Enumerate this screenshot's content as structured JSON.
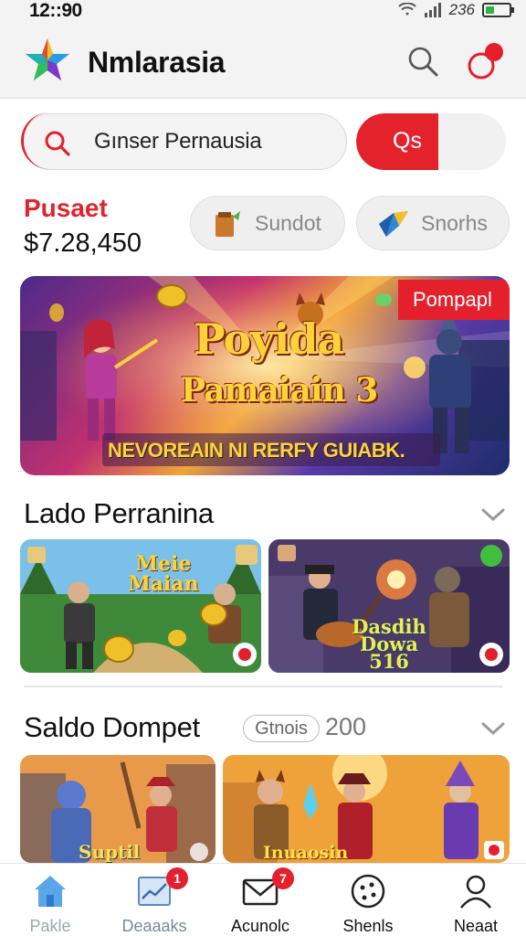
{
  "status_bar": {
    "time": "12::90",
    "signal": "236"
  },
  "header": {
    "title": "Nmlarasia"
  },
  "search": {
    "value": "Gınser Pernausia",
    "button_label": "Qs"
  },
  "balance": {
    "label": "Pusaet",
    "value": "$7.28,450"
  },
  "quick_actions": [
    {
      "label": "Sundot",
      "icon": "wallet-icon"
    },
    {
      "label": "Snorhs",
      "icon": "diamond-icon"
    }
  ],
  "banner": {
    "badge": "Pompapl",
    "title_line1": "Poyida",
    "title_line2": "Pamaiain 3",
    "subtitle": "NEVOREAIN NI RERFY GUIABK."
  },
  "section_latest": {
    "title": "Lado Perranina",
    "cards": [
      {
        "title": "Meie Maian"
      },
      {
        "title": "Dasdih Dowa 516"
      }
    ]
  },
  "section_wallet": {
    "title": "Saldo Dompet",
    "pill": "Gtnois",
    "count": "200",
    "cards": [
      {
        "title": "Suptil"
      },
      {
        "title": "Inuaosin"
      }
    ]
  },
  "bottom_nav": [
    {
      "label": "Pakle",
      "icon": "home-icon",
      "badge": ""
    },
    {
      "label": "Deaaaks",
      "icon": "chart-icon",
      "badge": "1"
    },
    {
      "label": "Acunolc",
      "icon": "mail-icon",
      "badge": "7"
    },
    {
      "label": "Shenls",
      "icon": "cookie-icon",
      "badge": ""
    },
    {
      "label": "Neaat",
      "icon": "user-icon",
      "badge": ""
    }
  ],
  "colors": {
    "accent": "#e3202b",
    "gold": "#ffd23a",
    "background": "#ffffff"
  }
}
